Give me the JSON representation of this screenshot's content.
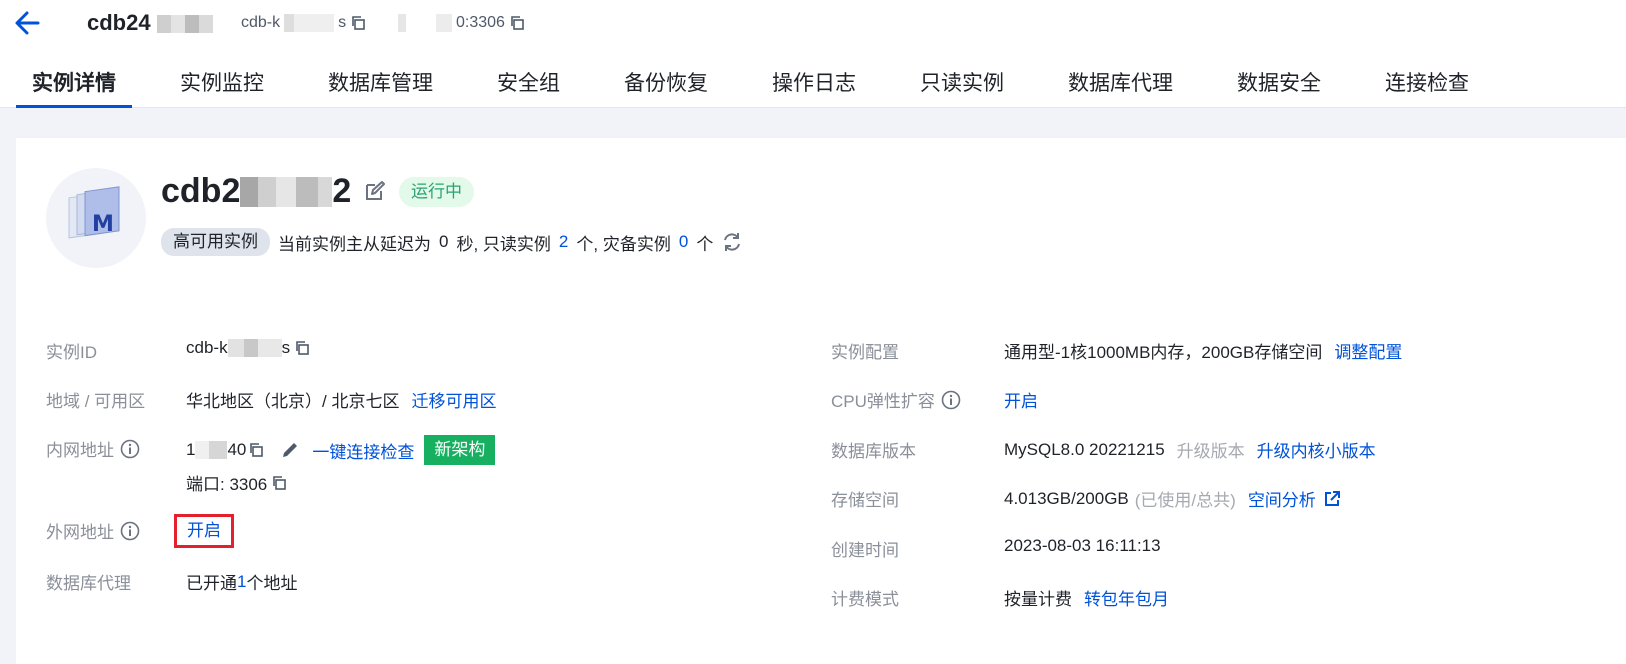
{
  "header": {
    "title": "cdb24",
    "instance_id": "cdb-k",
    "instance_id_tail": "s",
    "address_port": "0:3306"
  },
  "tabs": [
    {
      "label": "实例详情",
      "active": true
    },
    {
      "label": "实例监控"
    },
    {
      "label": "数据库管理"
    },
    {
      "label": "安全组"
    },
    {
      "label": "备份恢复"
    },
    {
      "label": "操作日志"
    },
    {
      "label": "只读实例"
    },
    {
      "label": "数据库代理"
    },
    {
      "label": "数据安全"
    },
    {
      "label": "连接检查"
    }
  ],
  "instance": {
    "name_prefix": "cdb2",
    "name_suffix": "2",
    "status": "运行中",
    "type_badge": "高可用实例",
    "delay_text": "当前实例主从延迟为",
    "delay_value": "0",
    "delay_unit": "秒, 只读实例",
    "readonly_count": "2",
    "readonly_unit": "个, 灾备实例",
    "dr_count": "0",
    "dr_unit": "个"
  },
  "left_info": {
    "id_label": "实例ID",
    "id_value": "cdb-k",
    "id_tail": "s",
    "region_label": "地域 / 可用区",
    "region_value": "华北地区（北京）/ 北京七区",
    "region_link": "迁移可用区",
    "private_label": "内网地址",
    "private_prefix": "1",
    "private_tail": "40",
    "connect_check": "一键连接检查",
    "new_arch": "新架构",
    "port_text": "端口: 3306",
    "public_label": "外网地址",
    "public_value": "开启",
    "proxy_label": "数据库代理",
    "proxy_prefix": "已开通",
    "proxy_count": "1",
    "proxy_suffix": "个地址"
  },
  "right_info": {
    "config_label": "实例配置",
    "config_value": "通用型-1核1000MB内存，200GB存储空间",
    "config_link": "调整配置",
    "cpu_label": "CPU弹性扩容",
    "cpu_value": "开启",
    "version_label": "数据库版本",
    "version_value": "MySQL8.0 20221215",
    "version_disabled": "升级版本",
    "version_link": "升级内核小版本",
    "storage_label": "存储空间",
    "storage_value": "4.013GB/200GB",
    "storage_note": "(已使用/总共)",
    "storage_link": "空间分析",
    "created_label": "创建时间",
    "created_value": "2023-08-03 16:11:13",
    "billing_label": "计费模式",
    "billing_value": "按量计费",
    "billing_link": "转包年包月"
  },
  "colors": {
    "accent": "#0052d9",
    "status_green": "#2ba471",
    "new_arch_green": "#16b060",
    "highlight_red": "#e4202d"
  }
}
